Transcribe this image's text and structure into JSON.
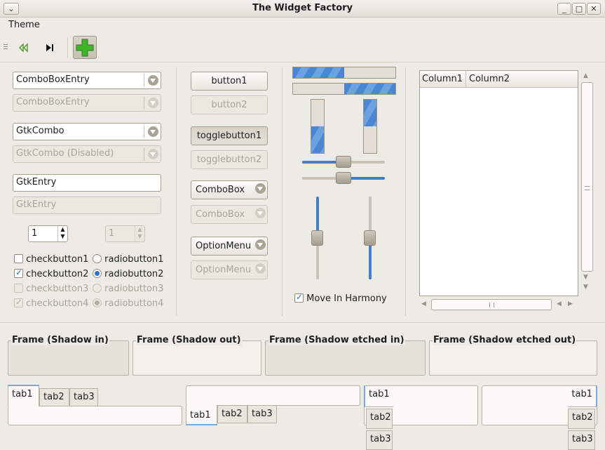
{
  "window": {
    "title": "The Widget Factory",
    "buttons": [
      "⌄",
      "_",
      "□",
      "✕"
    ]
  },
  "menu": {
    "theme": "Theme"
  },
  "toolbar": {
    "items": [
      "grip-icon",
      "rewind-icon",
      "skip-forward-icon",
      "add-icon"
    ]
  },
  "col1": {
    "combo_entry": "ComboBoxEntry",
    "combo_entry_disabled": "ComboBoxEntry",
    "gtk_combo": "GtkCombo",
    "gtk_combo_disabled": "GtkCombo (Disabled)",
    "gtk_entry": "GtkEntry",
    "gtk_entry_disabled": "GtkEntry",
    "spin_value": "1",
    "spin_disabled_value": "1",
    "checks": [
      "checkbutton1",
      "checkbutton2",
      "checkbutton3",
      "checkbutton4"
    ],
    "radios": [
      "radiobutton1",
      "radiobutton2",
      "radiobutton3",
      "radiobutton4"
    ]
  },
  "col2": {
    "button1": "button1",
    "button2": "button2",
    "toggle1": "togglebutton1",
    "toggle2": "togglebutton2",
    "combobox": "ComboBox",
    "combobox_disabled": "ComboBox",
    "optionmenu": "OptionMenu",
    "optionmenu_disabled": "OptionMenu"
  },
  "col3": {
    "progress_h1": 0.5,
    "progress_h2": 0.5,
    "progress_v1": 0.5,
    "progress_v2": 0.5,
    "scale_h1": 0.5,
    "scale_h2": 0.5,
    "scale_v1": 0.5,
    "scale_v2": 0.5,
    "move_in_harmony": "Move In Harmony"
  },
  "tree": {
    "columns": [
      "Column1",
      "Column2"
    ]
  },
  "frames": [
    "Frame (Shadow in)",
    "Frame (Shadow out)",
    "Frame (Shadow etched in)",
    "Frame (Shadow etched out)"
  ],
  "tabs": [
    "tab1",
    "tab2",
    "tab3"
  ],
  "colors": {
    "accent": "#4a86d1",
    "window_bg": "#edebe5"
  }
}
